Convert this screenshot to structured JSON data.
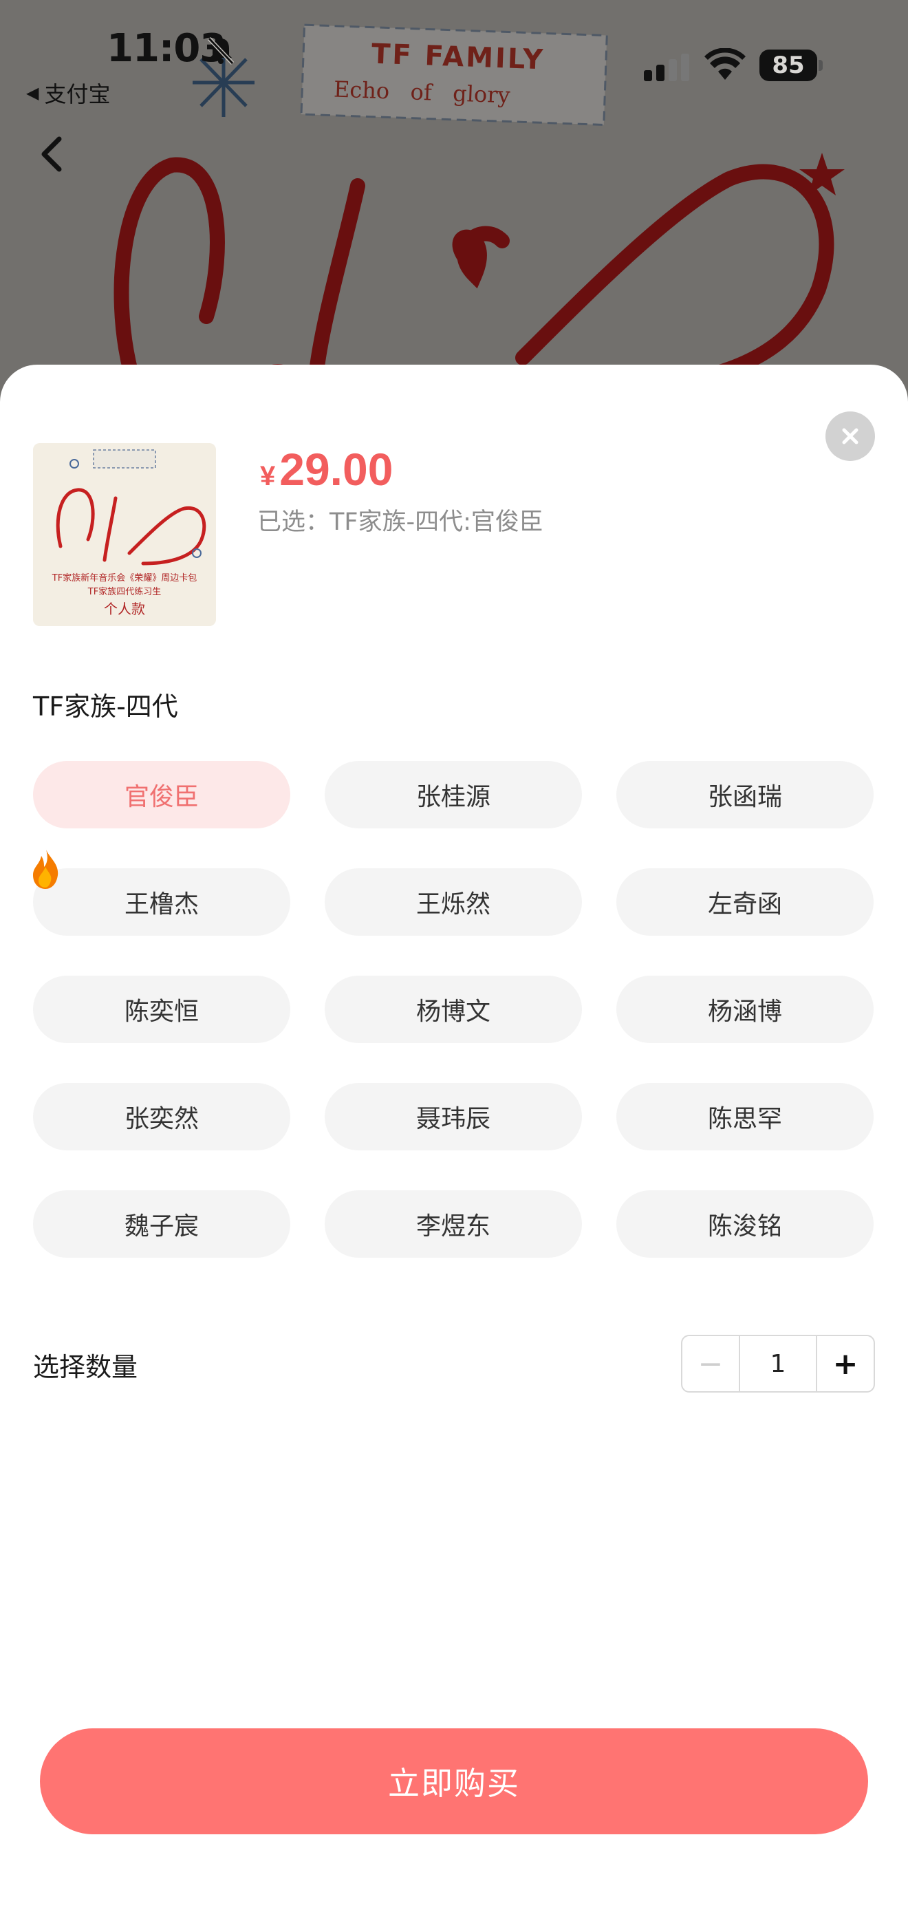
{
  "status_bar": {
    "time": "11:03",
    "back_app": "支付宝",
    "battery": "85"
  },
  "background_image": {
    "tag_line1": "TF FAMILY",
    "tag_line2": "Echo   of   glory"
  },
  "product": {
    "currency": "¥",
    "price": "29.00",
    "selected_text": "已选：TF家族-四代:官俊臣",
    "thumbnail_caption_line1": "TF家族新年音乐会《荣耀》周边卡包",
    "thumbnail_caption_line2": "TF家族四代练习生",
    "thumbnail_caption_line3": "个人款"
  },
  "spec_group": {
    "title": "TF家族-四代",
    "options": [
      {
        "label": "官俊臣",
        "active": true
      },
      {
        "label": "张桂源",
        "active": false
      },
      {
        "label": "张函瑞",
        "active": false
      },
      {
        "label": "王橹杰",
        "active": false
      },
      {
        "label": "王烁然",
        "active": false
      },
      {
        "label": "左奇函",
        "active": false
      },
      {
        "label": "陈奕恒",
        "active": false
      },
      {
        "label": "杨博文",
        "active": false
      },
      {
        "label": "杨涵博",
        "active": false
      },
      {
        "label": "张奕然",
        "active": false
      },
      {
        "label": "聂玮辰",
        "active": false
      },
      {
        "label": "陈思罕",
        "active": false
      },
      {
        "label": "魏子宸",
        "active": false
      },
      {
        "label": "李煜东",
        "active": false
      },
      {
        "label": "陈浚铭",
        "active": false
      }
    ]
  },
  "quantity": {
    "label": "选择数量",
    "minus": "−",
    "value": "1",
    "plus": "+"
  },
  "buy_button": {
    "label": "立即购买"
  },
  "colors": {
    "accent": "#f25d5d",
    "button": "#ff7472",
    "active_option_bg": "#fde8e8"
  },
  "icons": [
    "bell-slash-icon",
    "signal-icon",
    "wifi-icon",
    "back-chevron-icon",
    "close-icon",
    "flame-icon"
  ]
}
